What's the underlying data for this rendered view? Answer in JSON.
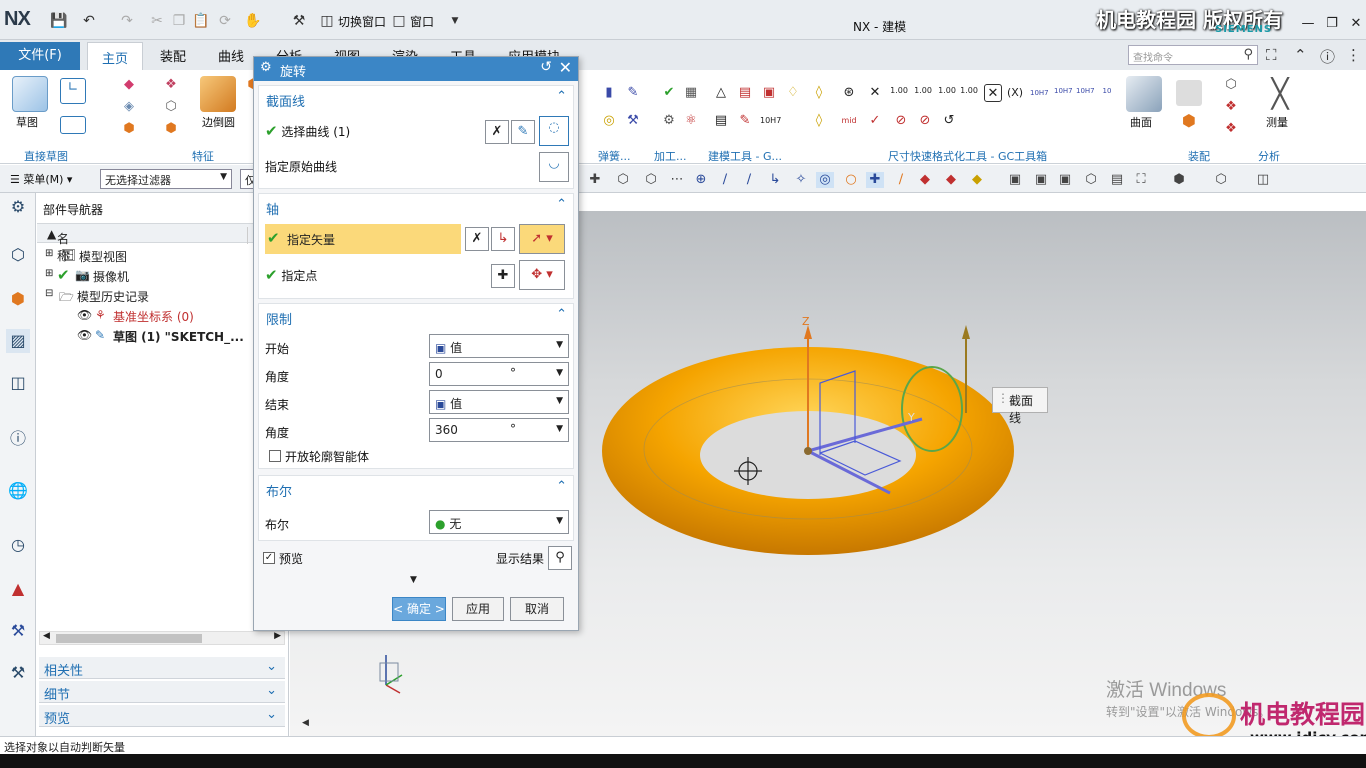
{
  "app": {
    "logo": "NX",
    "title": "NX - 建模",
    "watermark": "机电教程园 版权所有",
    "brand": "SIEMENS",
    "quick_access": {
      "switch_window": "切换窗口",
      "window": "窗口"
    }
  },
  "ribbon": {
    "file_tab": "文件(F)",
    "tabs": [
      "主页",
      "装配",
      "曲线",
      "分析",
      "视图",
      "渲染",
      "工具",
      "应用模块"
    ],
    "search_placeholder": "查找命令",
    "groups": {
      "sketch_label": "草图",
      "direct_sketch": "直接草图",
      "feature": "特征",
      "edge_blend": "边倒圆",
      "spring": "弹簧...",
      "machining": "加工...",
      "modeling_tools": "建模工具 - G...",
      "dimension_tools": "尺寸快速格式化工具 - GC工具箱",
      "surface": "曲面",
      "assembly": "装配",
      "measure": "测量",
      "analysis": "分析"
    }
  },
  "selection_bar": {
    "menu": "菜单(M)",
    "filter": "无选择过滤器",
    "partial": "仅"
  },
  "navigator": {
    "title": "部件导航器",
    "col_name": "名称",
    "col_trunc": "肖",
    "items": [
      {
        "label": "模型视图"
      },
      {
        "label": "摄像机"
      },
      {
        "label": "模型历史记录"
      },
      {
        "label": "基准坐标系 (0)"
      },
      {
        "label": "草图 (1) \"SKETCH_..."
      }
    ],
    "panels": [
      "相关性",
      "细节",
      "预览"
    ]
  },
  "dialog": {
    "title": "旋转",
    "section_curve": {
      "title": "截面线",
      "select_curve": "选择曲线 (1)",
      "specify_origin_curve": "指定原始曲线"
    },
    "axis": {
      "title": "轴",
      "specify_vector": "指定矢量",
      "specify_point": "指定点"
    },
    "limits": {
      "title": "限制",
      "start_label": "开始",
      "start_value": "值",
      "start_angle_label": "角度",
      "start_angle": "0",
      "end_label": "结束",
      "end_value": "值",
      "end_angle_label": "角度",
      "end_angle": "360",
      "unit": "°",
      "open_profile": "开放轮廓智能体"
    },
    "boolean": {
      "title": "布尔",
      "label": "布尔",
      "value": "无"
    },
    "preview": "预览",
    "show_result": "显示结果",
    "ok": "< 确定 >",
    "apply": "应用",
    "cancel": "取消"
  },
  "viewport": {
    "section_callout": "截面线",
    "axis_z": "Z",
    "axis_y": "Y",
    "activate_windows": "激活 Windows",
    "activate_hint": "转到\"设置\"以激活 Windows。",
    "watermark_logo": "机电教程园",
    "watermark_url": "www.jdjcy.com"
  },
  "status": {
    "message": "选择对象以自动判断矢量"
  },
  "colors": {
    "accent": "#3b86c6",
    "torus": "#f5a400",
    "highlight": "#fbd97a",
    "check": "#2ca02c"
  }
}
